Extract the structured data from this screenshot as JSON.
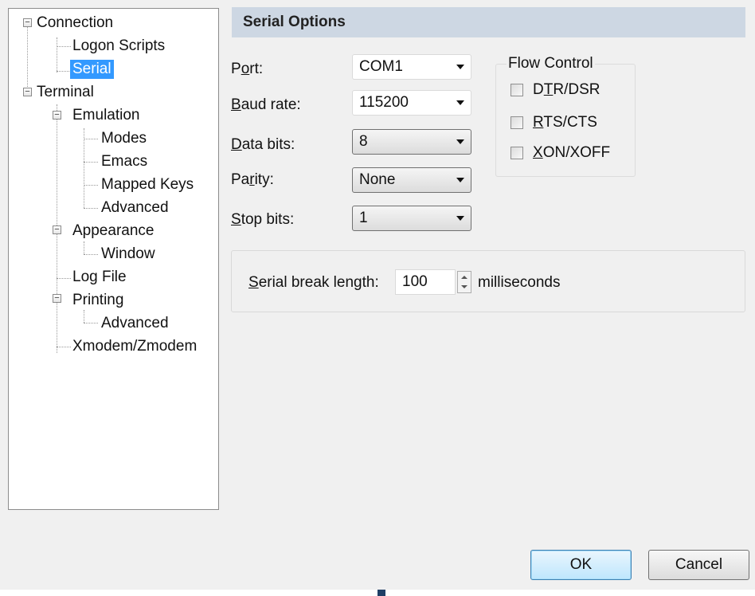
{
  "tree": {
    "items": [
      {
        "label": "Connection",
        "expander": "⊟"
      },
      {
        "label": "Logon Scripts"
      },
      {
        "label": "Serial",
        "selected": true
      },
      {
        "label": "Terminal",
        "expander": "⊟"
      },
      {
        "label": "Emulation",
        "expander": "⊟"
      },
      {
        "label": "Modes"
      },
      {
        "label": "Emacs"
      },
      {
        "label": "Mapped Keys"
      },
      {
        "label": "Advanced"
      },
      {
        "label": "Appearance",
        "expander": "⊟"
      },
      {
        "label": "Window"
      },
      {
        "label": "Log File"
      },
      {
        "label": "Printing",
        "expander": "⊟"
      },
      {
        "label": "Advanced"
      },
      {
        "label": "Xmodem/Zmodem"
      }
    ]
  },
  "header": {
    "title": "Serial Options"
  },
  "fields": {
    "port": {
      "label_prefix": "P",
      "label_u": "o",
      "label_rest": "rt:",
      "value": "COM1"
    },
    "baud": {
      "label_u": "B",
      "label_rest": "aud rate:",
      "value": "115200"
    },
    "databits": {
      "label_u": "D",
      "label_rest": "ata bits:",
      "value": "8"
    },
    "parity": {
      "label_prefix": "Pa",
      "label_u": "r",
      "label_rest": "ity:",
      "value": "None"
    },
    "stopbits": {
      "label_u": "S",
      "label_rest": "top bits:",
      "value": "1"
    }
  },
  "flow_control": {
    "legend": "Flow Control",
    "dtr": {
      "prefix": "D",
      "u": "T",
      "rest": "R/DSR",
      "checked": false
    },
    "rts": {
      "prefix": "",
      "u": "R",
      "rest": "TS/CTS",
      "checked": false
    },
    "xon": {
      "prefix": "",
      "u": "X",
      "rest": "ON/XOFF",
      "checked": false
    }
  },
  "break": {
    "label_u": "S",
    "label_rest": "erial break length:",
    "value": "100",
    "unit": "milliseconds"
  },
  "buttons": {
    "ok": "OK",
    "cancel": "Cancel"
  },
  "colors": {
    "selection": "#3399ff",
    "header_bg": "#cdd7e3"
  }
}
